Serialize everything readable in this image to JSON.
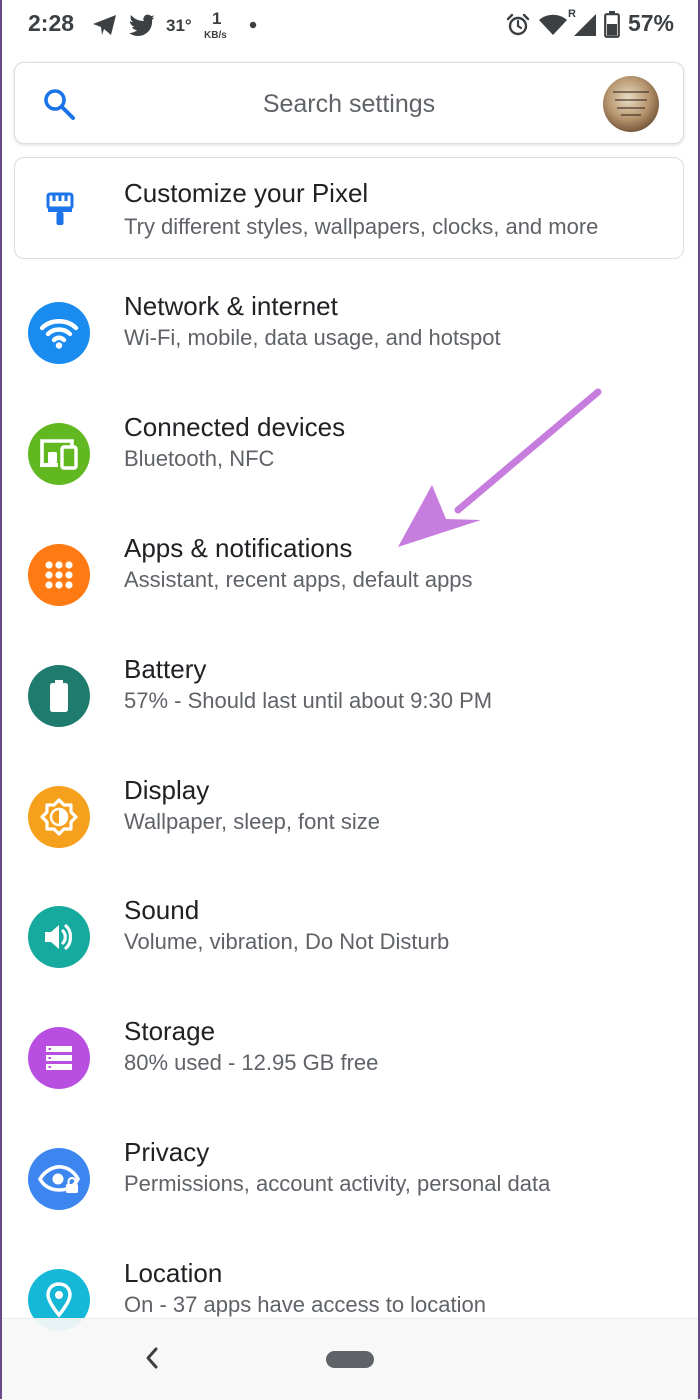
{
  "status_bar": {
    "time": "2:28",
    "temperature": "31°",
    "network_speed_value": "1",
    "network_speed_unit": "KB/s",
    "roaming_indicator": "R",
    "battery_percent": "57%",
    "icons": [
      "telegram-icon",
      "twitter-icon",
      "dot-icon",
      "alarm-icon",
      "wifi-icon",
      "signal-icon",
      "battery-icon"
    ]
  },
  "search": {
    "placeholder": "Search settings"
  },
  "customize": {
    "title": "Customize your Pixel",
    "subtitle": "Try different styles, wallpapers, clocks, and more",
    "icon": "brush-icon",
    "icon_color": "#1a73e8"
  },
  "settings": [
    {
      "title": "Network & internet",
      "subtitle": "Wi-Fi, mobile, data usage, and hotspot",
      "icon": "wifi-icon",
      "color": "#1a8cf0"
    },
    {
      "title": "Connected devices",
      "subtitle": "Bluetooth, NFC",
      "icon": "devices-icon",
      "color": "#61b821"
    },
    {
      "title": "Apps & notifications",
      "subtitle": "Assistant, recent apps, default apps",
      "icon": "apps-icon",
      "color": "#ff7a12"
    },
    {
      "title": "Battery",
      "subtitle": "57% - Should last until about 9:30 PM",
      "icon": "battery-icon",
      "color": "#1f7b6e"
    },
    {
      "title": "Display",
      "subtitle": "Wallpaper, sleep, font size",
      "icon": "brightness-icon",
      "color": "#f6a11d"
    },
    {
      "title": "Sound",
      "subtitle": "Volume, vibration, Do Not Disturb",
      "icon": "volume-icon",
      "color": "#16aa9e"
    },
    {
      "title": "Storage",
      "subtitle": "80% used - 12.95 GB free",
      "icon": "storage-icon",
      "color": "#b84fe0"
    },
    {
      "title": "Privacy",
      "subtitle": "Permissions, account activity, personal data",
      "icon": "privacy-icon",
      "color": "#3d86f0"
    },
    {
      "title": "Location",
      "subtitle": "On - 37 apps have access to location",
      "icon": "location-icon",
      "color": "#15b8d6"
    }
  ],
  "annotation": {
    "icon": "arrow-icon",
    "color": "#c77ddd"
  },
  "nav_bar": {
    "icons": [
      "back-icon",
      "home-pill"
    ]
  }
}
